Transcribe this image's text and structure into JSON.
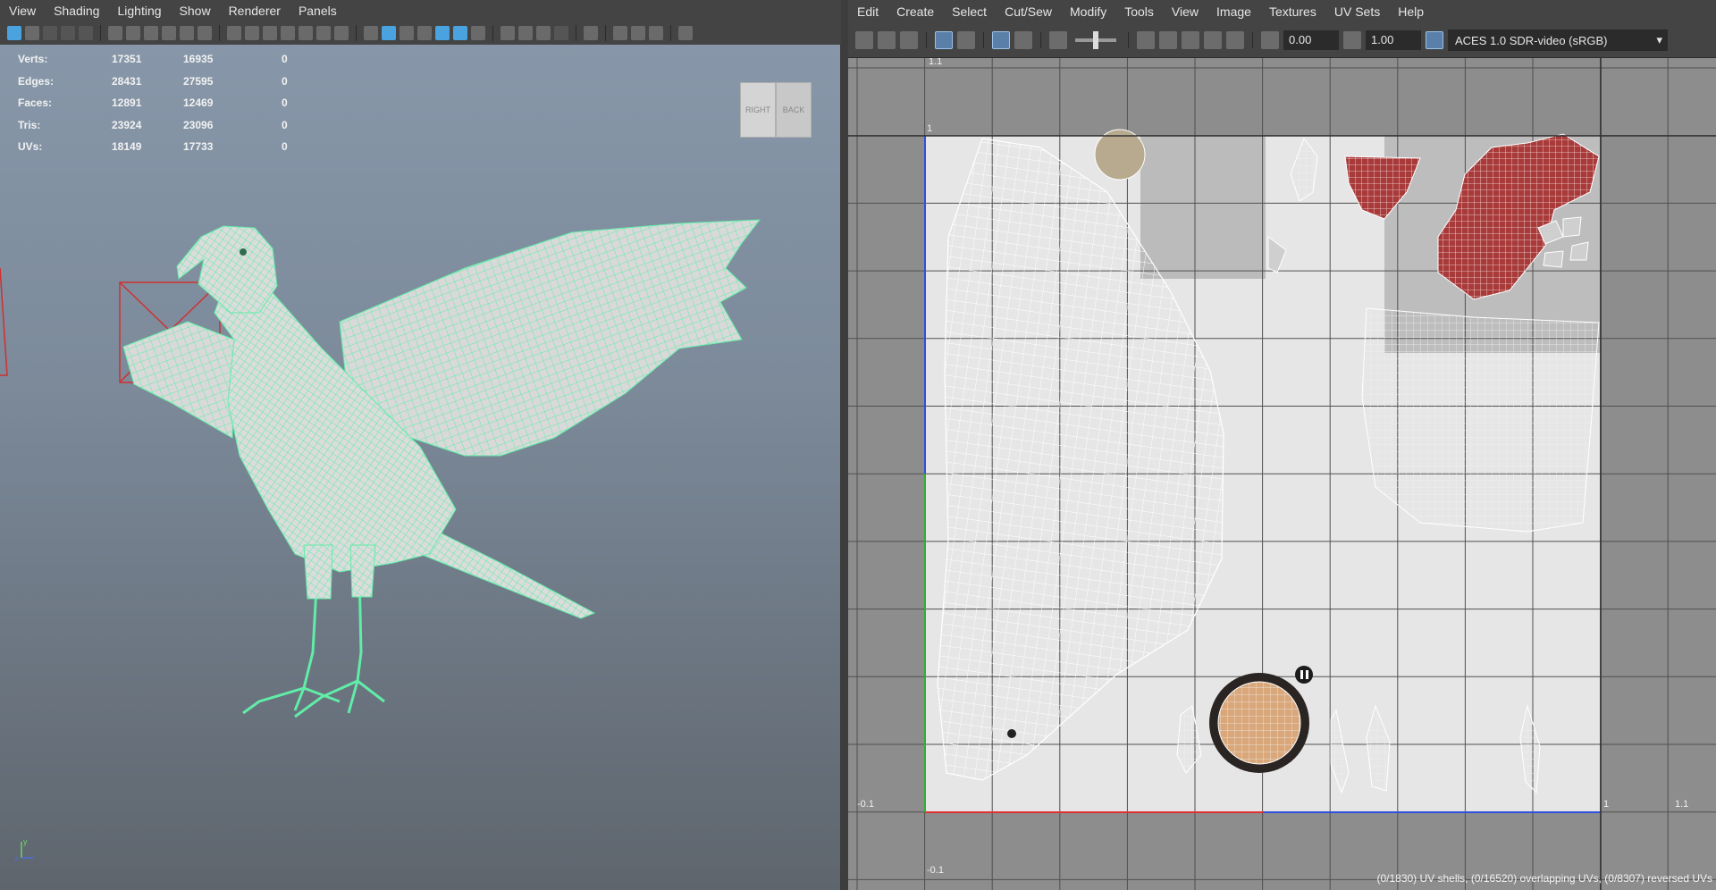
{
  "left_menu": [
    "View",
    "Shading",
    "Lighting",
    "Show",
    "Renderer",
    "Panels"
  ],
  "hud": {
    "rows": [
      {
        "label": "Verts:",
        "c1": "17351",
        "c2": "16935",
        "c3": "0"
      },
      {
        "label": "Edges:",
        "c1": "28431",
        "c2": "27595",
        "c3": "0"
      },
      {
        "label": "Faces:",
        "c1": "12891",
        "c2": "12469",
        "c3": "0"
      },
      {
        "label": "Tris:",
        "c1": "23924",
        "c2": "23096",
        "c3": "0"
      },
      {
        "label": "UVs:",
        "c1": "18149",
        "c2": "17733",
        "c3": "0"
      }
    ]
  },
  "view_cube": {
    "left_face": "RIGHT",
    "right_face": "BACK"
  },
  "axis_gizmo": {
    "y": "y",
    "z": "z"
  },
  "right_menu": [
    "Edit",
    "Create",
    "Select",
    "Cut/Sew",
    "Modify",
    "Tools",
    "View",
    "Image",
    "Textures",
    "UV Sets",
    "Help"
  ],
  "uv_toolbar": {
    "exposure": "0.00",
    "gamma": "1.00",
    "color_space": "ACES 1.0 SDR-video (sRGB)"
  },
  "uv_axis_labels": {
    "top_tick": "1.1",
    "v_one": "1",
    "bottom_left": "-0.1",
    "u_one": "1",
    "u_max": "1.1",
    "v_min": "-0.1"
  },
  "uv_status": "(0/1830) UV shells, (0/16520) overlapping UVs, (0/8307) reversed UVs",
  "colors": {
    "wireframe": "#61eca8",
    "viewport_top": "#8797a9",
    "viewport_bottom": "#5e656d",
    "uv_grid_bg": "#8d8d8d",
    "texture_bg": "#e9e9e9",
    "u_axis": "#e03030",
    "v_axis": "#3050e0"
  }
}
